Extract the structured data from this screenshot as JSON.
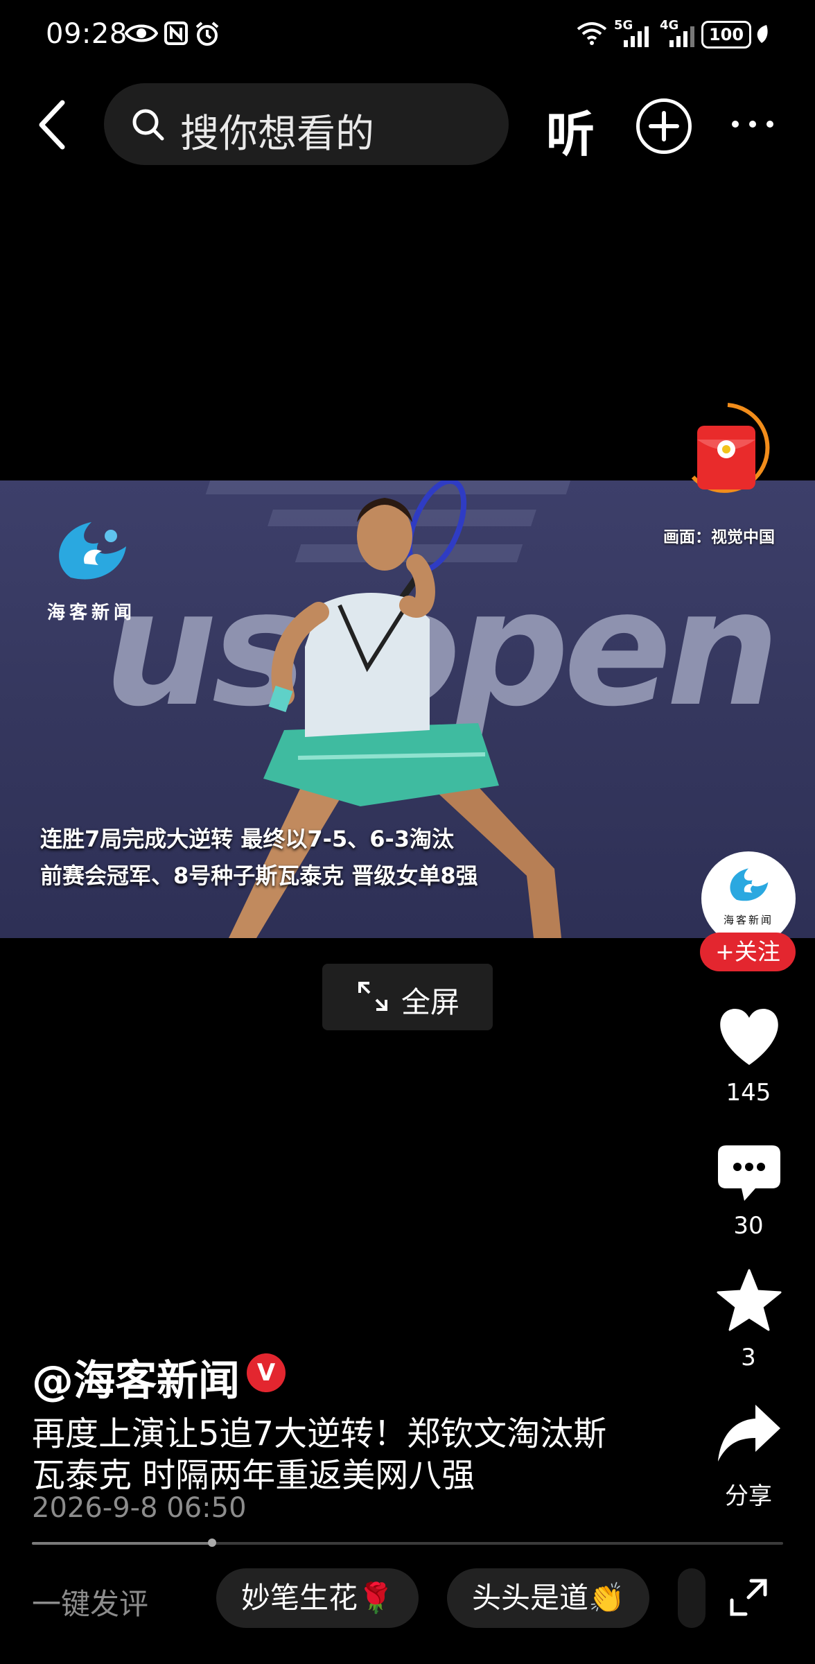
{
  "status_bar": {
    "time": "09:28",
    "icons": [
      "eye-icon",
      "nfc-icon",
      "alarm-icon",
      "wifi-icon",
      "signal-5g-icon",
      "signal-4g-icon",
      "leaf-icon"
    ],
    "network_5g": "5G",
    "network_4g": "4G",
    "battery": "100"
  },
  "top_bar": {
    "search_placeholder": "搜你想看的",
    "listen_label": "听"
  },
  "video": {
    "logo_text": "海客新闻",
    "caption_line1": "连胜7局完成大逆转 最终以7-5、6-3淘汰",
    "caption_line2": "前赛会冠军、8号种子斯瓦泰克 晋级女单8强",
    "credit": "画面：视觉中国",
    "banner_text": "us open",
    "progress": 0.24
  },
  "fullscreen_label": "全屏",
  "rail": {
    "avatar_text": "海客新闻",
    "follow_label": "+关注",
    "likes": "145",
    "comments": "30",
    "favorites": "3",
    "share_label": "分享"
  },
  "post": {
    "author": "@海客新闻",
    "verified_label": "V",
    "title_line1": "再度上演让5追7大逆转！郑钦文淘汰斯",
    "title_line2": "瓦泰克 时隔两年重返美网八强",
    "timestamp": "2026-9-8 06:50"
  },
  "comment_bar": {
    "quick_comment_label": "一键发评",
    "chips": [
      "妙笔生花🌹",
      "头头是道👏"
    ]
  },
  "colors": {
    "accent_red": "#e3262f",
    "background": "#000000",
    "chip_bg": "#222222"
  }
}
